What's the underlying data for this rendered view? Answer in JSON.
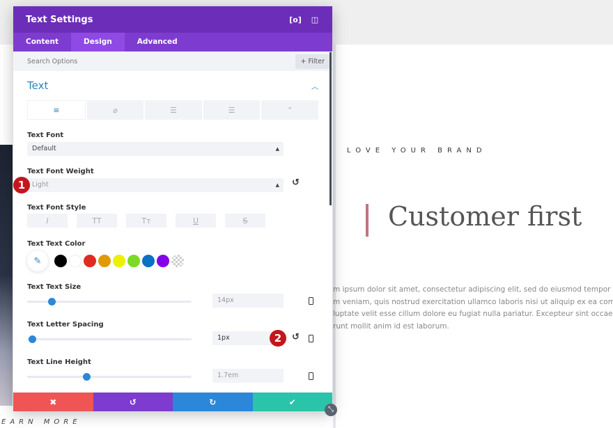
{
  "page": {
    "eyebrow": "LOVE YOUR BRAND",
    "headline": "Customer first",
    "body_lines": [
      "m ipsum dolor sit amet, consectetur adipiscing elit, sed do eiusmod tempor incid",
      "m veniam, quis nostrud exercitation ullamco laboris nisi ut aliquip ex ea commod",
      "luptate velit esse cillum dolore eu fugiat nulla pariatur. Excepteur sint occaecat c",
      "runt mollit anim id est laborum."
    ],
    "learn_more": "EARN MORE"
  },
  "panel": {
    "title": "Text Settings",
    "tabs": [
      "Content",
      "Design",
      "Advanced"
    ],
    "active_tab": "Design",
    "search_placeholder": "Search Options",
    "filter_label": "+ Filter",
    "section_title": "Text",
    "subtab_icons": [
      "align-left-icon",
      "link-icon",
      "unordered-list-icon",
      "ordered-list-icon",
      "quote-icon"
    ],
    "text_font": {
      "label": "Text Font",
      "value": "Default"
    },
    "font_weight": {
      "label": "Text Font Weight",
      "value": "Light"
    },
    "font_style": {
      "label": "Text Font Style",
      "buttons": [
        "I",
        "TT",
        "Tт",
        "U",
        "S"
      ]
    },
    "text_color": {
      "label": "Text Text Color",
      "swatches": [
        "#000000",
        "#ffffff",
        "#e02b20",
        "#e09900",
        "#edf000",
        "#7cda24",
        "#0c71c3",
        "#8300e9"
      ]
    },
    "text_size": {
      "label": "Text Text Size",
      "value": "14px",
      "level": 0.15
    },
    "letter_spacing": {
      "label": "Text Letter Spacing",
      "value": "1px",
      "level": 0.03
    },
    "line_height": {
      "label": "Text Line Height",
      "value": "1.7em",
      "level": 0.36
    },
    "footer": {
      "cancel": "✖",
      "undo": "↺",
      "redo": "↻",
      "save": "✔",
      "colors": [
        "#ef5555",
        "#7e3bd0",
        "#2b87da",
        "#29c4a9"
      ]
    }
  },
  "badges": [
    "1",
    "2"
  ]
}
